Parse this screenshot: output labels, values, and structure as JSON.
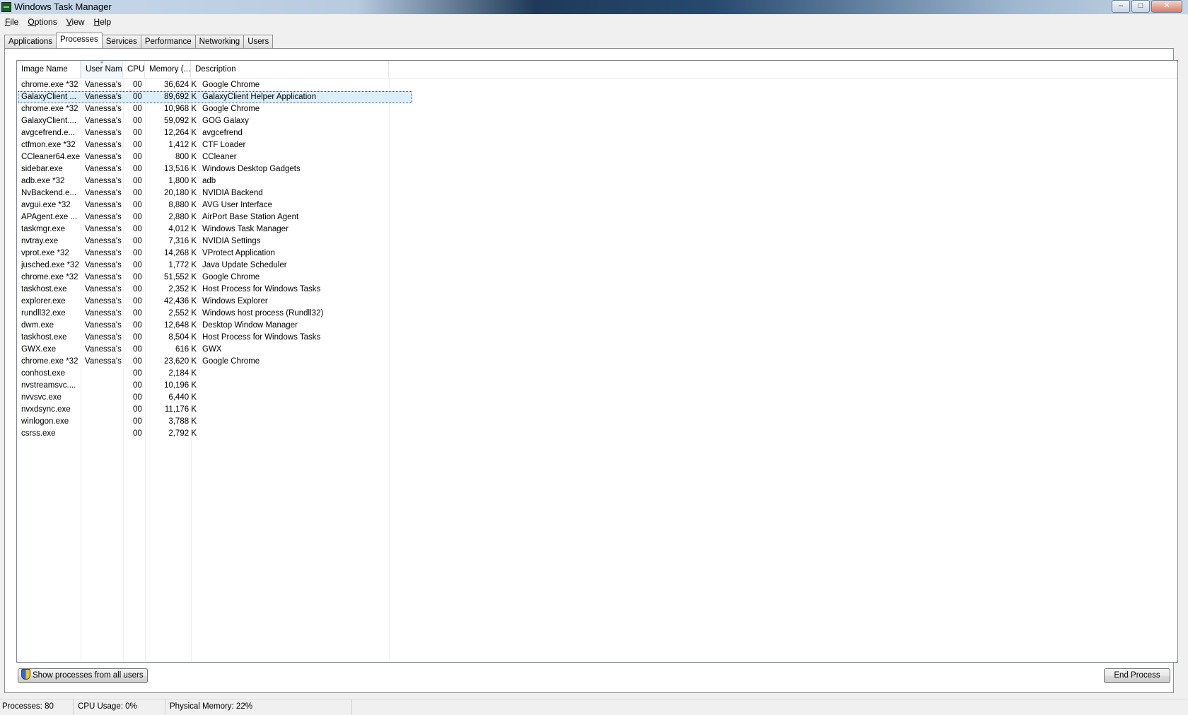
{
  "window": {
    "title": "Windows Task Manager",
    "controls": {
      "minimize": "‒",
      "maximize": "□",
      "close": "✕"
    }
  },
  "menu": [
    "File",
    "Options",
    "View",
    "Help"
  ],
  "tabs": [
    "Applications",
    "Processes",
    "Services",
    "Performance",
    "Networking",
    "Users"
  ],
  "active_tab": "Processes",
  "columns": [
    "Image Name",
    "User Name",
    "CPU",
    "Memory (...",
    "Description"
  ],
  "sorted_column": "User Name",
  "processes": [
    {
      "name": "chrome.exe *32",
      "user": "Vanessa's",
      "cpu": "00",
      "mem": "36,624 K",
      "desc": "Google Chrome"
    },
    {
      "name": "GalaxyClient ...",
      "user": "Vanessa's",
      "cpu": "00",
      "mem": "89,692 K",
      "desc": "GalaxyClient Helper Application"
    },
    {
      "name": "chrome.exe *32",
      "user": "Vanessa's",
      "cpu": "00",
      "mem": "10,968 K",
      "desc": "Google Chrome"
    },
    {
      "name": "GalaxyClient....",
      "user": "Vanessa's",
      "cpu": "00",
      "mem": "59,092 K",
      "desc": "GOG Galaxy"
    },
    {
      "name": "avgcefrend.e...",
      "user": "Vanessa's",
      "cpu": "00",
      "mem": "12,264 K",
      "desc": "avgcefrend"
    },
    {
      "name": "ctfmon.exe *32",
      "user": "Vanessa's",
      "cpu": "00",
      "mem": "1,412 K",
      "desc": "CTF Loader"
    },
    {
      "name": "CCleaner64.exe",
      "user": "Vanessa's",
      "cpu": "00",
      "mem": "800 K",
      "desc": "CCleaner"
    },
    {
      "name": "sidebar.exe",
      "user": "Vanessa's",
      "cpu": "00",
      "mem": "13,516 K",
      "desc": "Windows Desktop Gadgets"
    },
    {
      "name": "adb.exe *32",
      "user": "Vanessa's",
      "cpu": "00",
      "mem": "1,800 K",
      "desc": "adb"
    },
    {
      "name": "NvBackend.e...",
      "user": "Vanessa's",
      "cpu": "00",
      "mem": "20,180 K",
      "desc": "NVIDIA Backend"
    },
    {
      "name": "avgui.exe *32",
      "user": "Vanessa's",
      "cpu": "00",
      "mem": "8,880 K",
      "desc": "AVG User Interface"
    },
    {
      "name": "APAgent.exe ...",
      "user": "Vanessa's",
      "cpu": "00",
      "mem": "2,880 K",
      "desc": "AirPort Base Station Agent"
    },
    {
      "name": "taskmgr.exe",
      "user": "Vanessa's",
      "cpu": "00",
      "mem": "4,012 K",
      "desc": "Windows Task Manager"
    },
    {
      "name": "nvtray.exe",
      "user": "Vanessa's",
      "cpu": "00",
      "mem": "7,316 K",
      "desc": "NVIDIA Settings"
    },
    {
      "name": "vprot.exe *32",
      "user": "Vanessa's",
      "cpu": "00",
      "mem": "14,268 K",
      "desc": "VProtect Application"
    },
    {
      "name": "jusched.exe *32",
      "user": "Vanessa's",
      "cpu": "00",
      "mem": "1,772 K",
      "desc": "Java Update Scheduler"
    },
    {
      "name": "chrome.exe *32",
      "user": "Vanessa's",
      "cpu": "00",
      "mem": "51,552 K",
      "desc": "Google Chrome"
    },
    {
      "name": "taskhost.exe",
      "user": "Vanessa's",
      "cpu": "00",
      "mem": "2,352 K",
      "desc": "Host Process for Windows Tasks"
    },
    {
      "name": "explorer.exe",
      "user": "Vanessa's",
      "cpu": "00",
      "mem": "42,436 K",
      "desc": "Windows Explorer"
    },
    {
      "name": "rundll32.exe",
      "user": "Vanessa's",
      "cpu": "00",
      "mem": "2,552 K",
      "desc": "Windows host process (Rundll32)"
    },
    {
      "name": "dwm.exe",
      "user": "Vanessa's",
      "cpu": "00",
      "mem": "12,648 K",
      "desc": "Desktop Window Manager"
    },
    {
      "name": "taskhost.exe",
      "user": "Vanessa's",
      "cpu": "00",
      "mem": "8,504 K",
      "desc": "Host Process for Windows Tasks"
    },
    {
      "name": "GWX.exe",
      "user": "Vanessa's",
      "cpu": "00",
      "mem": "616 K",
      "desc": "GWX"
    },
    {
      "name": "chrome.exe *32",
      "user": "Vanessa's",
      "cpu": "00",
      "mem": "23,620 K",
      "desc": "Google Chrome"
    },
    {
      "name": "conhost.exe",
      "user": "",
      "cpu": "00",
      "mem": "2,184 K",
      "desc": ""
    },
    {
      "name": "nvstreamsvc....",
      "user": "",
      "cpu": "00",
      "mem": "10,196 K",
      "desc": ""
    },
    {
      "name": "nvvsvc.exe",
      "user": "",
      "cpu": "00",
      "mem": "6,440 K",
      "desc": ""
    },
    {
      "name": "nvxdsync.exe",
      "user": "",
      "cpu": "00",
      "mem": "11,176 K",
      "desc": ""
    },
    {
      "name": "winlogon.exe",
      "user": "",
      "cpu": "00",
      "mem": "3,788 K",
      "desc": ""
    },
    {
      "name": "csrss.exe",
      "user": "",
      "cpu": "00",
      "mem": "2,792 K",
      "desc": ""
    }
  ],
  "selected_row": 1,
  "buttons": {
    "show_all": "Show processes from all users",
    "end_process": "End Process"
  },
  "icons": {
    "app": "task-manager-icon",
    "shield": "uac-shield-icon"
  },
  "status": {
    "processes": "Processes: 80",
    "cpu": "CPU Usage: 0%",
    "memory": "Physical Memory: 22%"
  }
}
